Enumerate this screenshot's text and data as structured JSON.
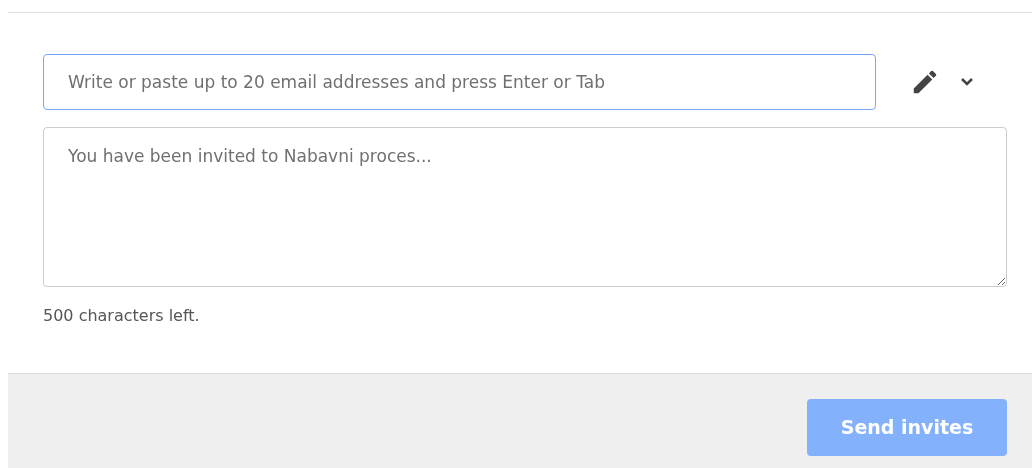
{
  "email_field": {
    "placeholder": "Write or paste up to 20 email addresses and press Enter or Tab",
    "focused": true
  },
  "message_field": {
    "placeholder": "You have been invited to Nabavni proces..."
  },
  "char_count": "500 characters left.",
  "send_button": {
    "label": "Send invites",
    "disabled": true
  }
}
